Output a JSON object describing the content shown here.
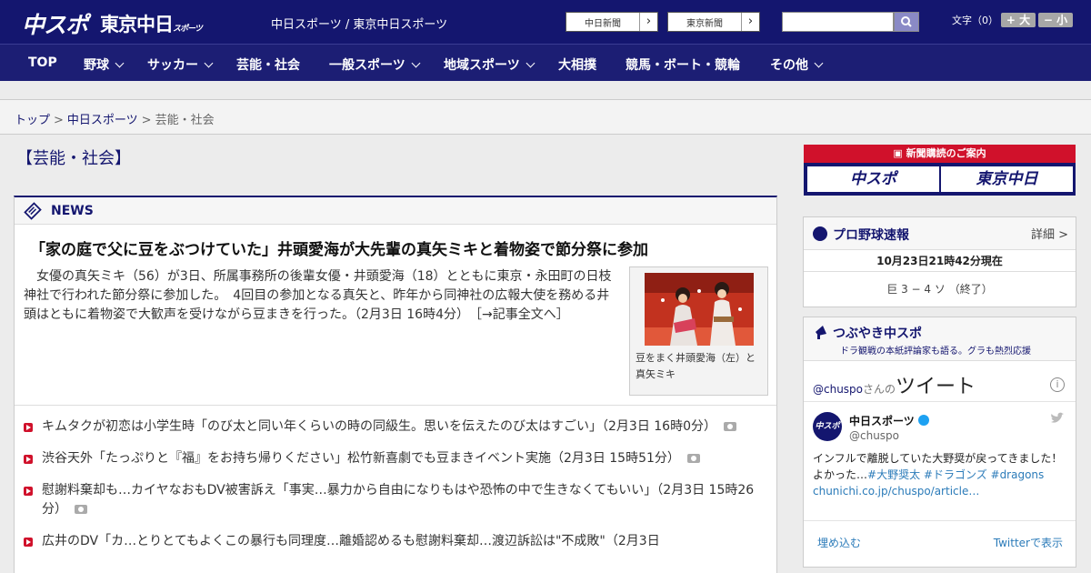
{
  "header": {
    "logo_chuspo": "中スポ",
    "logo_tokyo": "東京中日",
    "logo_tokyo_small": "スポーツ",
    "site_names": "中日スポーツ / 東京中日スポーツ",
    "paper_links": [
      "中日新聞",
      "東京新聞"
    ],
    "search_placeholder": "",
    "font_size_label": "文字（0）",
    "font_larger": "+ 大",
    "font_smaller": "− 小"
  },
  "nav": {
    "items": [
      {
        "label": "TOP",
        "dropdown": false
      },
      {
        "label": "野球",
        "dropdown": true
      },
      {
        "label": "サッカー",
        "dropdown": true
      },
      {
        "label": "芸能・社会",
        "dropdown": false
      },
      {
        "label": "一般スポーツ",
        "dropdown": true
      },
      {
        "label": "地域スポーツ",
        "dropdown": true
      },
      {
        "label": "大相撲",
        "dropdown": false
      },
      {
        "label": "競馬・ボート・競輪",
        "dropdown": false
      },
      {
        "label": "その他",
        "dropdown": true
      }
    ]
  },
  "breadcrumb": {
    "items": [
      "トップ",
      "中日スポーツ",
      "芸能・社会"
    ],
    "separator": ">"
  },
  "main": {
    "page_title": "【芸能・社会】",
    "section_label": "NEWS",
    "headline": "「家の庭で父に豆をぶつけていた」井頭愛海が大先輩の真矢ミキと着物姿で節分祭に参加",
    "lead": "女優の真矢ミキ（56）が3日、所属事務所の後輩女優・井頭愛海（18）とともに東京・永田町の日枝神社で行われた節分祭に参加した。　4回目の参加となる真矢と、昨年から同神社の広報大使を務める井頭はともに着物姿で大歓声を受けながら豆まきを行った。（2月3日 16時4分）",
    "lead_more": "［→記事全文へ］",
    "photo_caption": "豆をまく井頭愛海（左）と真矢ミキ",
    "news_items": [
      {
        "title": "キムタクが初恋は小学生時「のび太と同い年くらいの時の同級生。思いを伝えたのび太はすごい」",
        "time": "（2月3日 16時0分）",
        "has_photo": true
      },
      {
        "title": "渋谷天外「たっぷりと『福』をお持ち帰りください」松竹新喜劇でも豆まきイベント実施",
        "time": "（2月3日 15時51分）",
        "has_photo": true
      },
      {
        "title": "慰謝料棄却も…カイヤなおもDV被害訴え「事実…暴力から自由になりもはや恐怖の中で生きなくてもいい」",
        "time": "（2月3日 15時26分）",
        "has_photo": true
      },
      {
        "title": "広井のDV「カ…とりとてもよくこの暴行も同理度…離婚認めるも慰謝料棄却…渡辺訴訟は\"不成敗\"",
        "time": "（2月3日",
        "has_photo": false
      }
    ]
  },
  "sidebar": {
    "subscription_title": "新聞購読のご案内",
    "subscription_buttons": [
      "中スポ",
      "東京中日"
    ],
    "baseball": {
      "title": "プロ野球速報",
      "more": "詳細 >",
      "time": "10月23日21時42分現在",
      "score": "巨 3 − 4 ソ （終了）"
    },
    "tweets": {
      "title": "つぶやき中スポ",
      "subtitle": "ドラ観戦の本紙評論家も語る。グラも熱烈応援",
      "handle_link": "@chuspo",
      "san": "さんの",
      "tweet_word": "ツイート",
      "account_name": "中日スポーツ",
      "account_handle": "@chuspo",
      "avatar_text": "中スポ",
      "text_line1": "インフルで離脱していた大野奨が戻ってきました！",
      "text_line2_prefix": "よかった…",
      "hashtags": "#大野奨太 #ドラゴンズ #dragons",
      "link": "chunichi.co.jp/chuspo/article…",
      "embed": "埋め込む",
      "view_on_twitter": "Twitterで表示"
    }
  },
  "colors": {
    "brand_navy": "#14166f",
    "accent_red": "#d0112b",
    "link_blue": "#2b7bb9"
  }
}
